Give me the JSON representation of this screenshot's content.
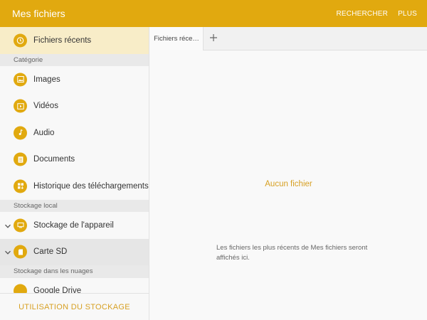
{
  "colors": {
    "accent": "#e1a90f",
    "accent_text": "#d7a023",
    "active_bg": "#f8edc8"
  },
  "header": {
    "title": "Mes fichiers",
    "actions": [
      "RECHERCHER",
      "PLUS"
    ]
  },
  "sidebar": {
    "recent": {
      "label": "Fichiers récents",
      "icon": "clock-icon"
    },
    "category_header": "Catégorie",
    "categories": [
      {
        "label": "Images",
        "icon": "image-icon"
      },
      {
        "label": "Vidéos",
        "icon": "video-icon"
      },
      {
        "label": "Audio",
        "icon": "music-note-icon"
      },
      {
        "label": "Documents",
        "icon": "document-icon"
      },
      {
        "label": "Historique des téléchargements",
        "icon": "download-history-icon"
      }
    ],
    "local_header": "Stockage local",
    "local": [
      {
        "label": "Stockage de l'appareil",
        "icon": "device-storage-icon"
      },
      {
        "label": "Carte SD",
        "icon": "sd-card-icon"
      }
    ],
    "cloud_header": "Stockage dans les nuages",
    "cloud": [
      {
        "label": "Google Drive",
        "icon": "google-drive-icon"
      }
    ],
    "footer_label": "UTILISATION DU STOCKAGE"
  },
  "tabs": {
    "active_label": "Fichiers réce…",
    "add_icon": "plus-icon"
  },
  "content": {
    "empty_title": "Aucun fichier",
    "empty_desc": "Les fichiers les plus récents de Mes fichiers seront affichés ici."
  }
}
